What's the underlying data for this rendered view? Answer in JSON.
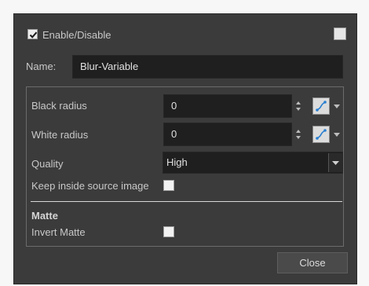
{
  "header": {
    "enable_label": "Enable/Disable",
    "enable_checked": true
  },
  "name": {
    "label": "Name:",
    "value": "Blur-Variable"
  },
  "params": {
    "black_radius_label": "Black radius",
    "black_radius_value": "0",
    "white_radius_label": "White radius",
    "white_radius_value": "0",
    "quality_label": "Quality",
    "quality_value": "High",
    "keep_inside_label": "Keep inside source image",
    "keep_inside_checked": false
  },
  "matte": {
    "heading": "Matte",
    "invert_label": "Invert Matte",
    "invert_checked": false
  },
  "footer": {
    "close_label": "Close"
  },
  "colors": {
    "dialog_bg": "#3b3b3b",
    "field_bg": "#1f1f1f",
    "function_button_accent": "#2a7fd0"
  }
}
